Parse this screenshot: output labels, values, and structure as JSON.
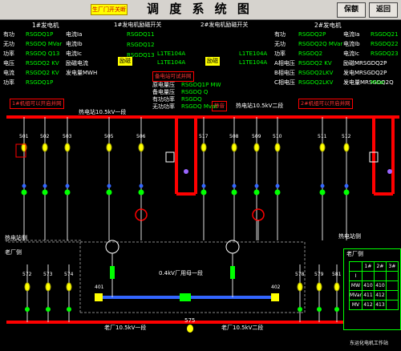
{
  "header": {
    "title": "调 度 系 统 图",
    "warn_badge": "生厂门开关断",
    "btn_left": "保额",
    "btn_right": "返回"
  },
  "gen1": {
    "title": "1#发电机",
    "rows": [
      {
        "label": "有功",
        "value": "RSGDQ1P",
        "unit": "电流Ia"
      },
      {
        "label": "无功",
        "value": "RSGDQ MVar",
        "unit": "电流Ib"
      },
      {
        "label": "功率",
        "value": "RSGDQ Q13",
        "unit": "电流Ic"
      },
      {
        "label": "电压",
        "value": "RSGDQ2 KV",
        "unit": "励磁电流"
      },
      {
        "label": "电流",
        "value": "RSGDQ2 KV",
        "unit": "发电量MWH"
      },
      {
        "label": "功率",
        "value": "RSGDQ1P",
        "unit": ""
      }
    ]
  },
  "gen2": {
    "title": "2#发电机",
    "rows": [
      {
        "label": "有功",
        "value": "RSGDQ2P",
        "unit": "电流Ia",
        "extra": "RSGDQ21"
      },
      {
        "label": "无功",
        "value": "RSGDQ2Q MVar",
        "unit": "电流Ib",
        "extra": "RSGDQ22"
      },
      {
        "label": "功率",
        "value": "RSGDQ2",
        "unit": "电流Ic",
        "extra": "RSGDQ23"
      },
      {
        "label": "A相电压",
        "value": "RSGDQ2 KV",
        "unit": "励磁MRSGDQ2P",
        "extra": ""
      },
      {
        "label": "B相电压",
        "value": "RSGDQ2LKV",
        "unit": "发电MRSGDQ2P",
        "extra": ""
      },
      {
        "label": "C相电压",
        "value": "RSGDQ2LKV",
        "unit": "发电量MRSGDQ2Q",
        "extra": "MVar"
      }
    ]
  },
  "center_left": {
    "title": "1#发电机励磁开关",
    "rows": [
      "RSGDQ11",
      "RSGDQ12",
      "RSGDQ13"
    ],
    "tag": "励磁",
    "sub_rows": [
      "L1TE104A",
      "L1TE104A"
    ]
  },
  "center_right": {
    "title": "2#发电机励磁开关",
    "tag": "励磁",
    "sub_rows": [
      "L1TE104A",
      "L1TE104A"
    ]
  },
  "sync_panel": {
    "title": "备电站可试并网",
    "rows": [
      {
        "label": "原电量压",
        "value": "RSGDQ1P MW"
      },
      {
        "label": "备电量压",
        "value": "RSGDQ Q"
      },
      {
        "label": "有功功率",
        "value": "RSGDQ"
      },
      {
        "label": "无功功率",
        "value": "RSGDQ Mvar"
      }
    ]
  },
  "alerts": {
    "left": "1#机组可以开启并网",
    "right": "2#机组可以开启并网",
    "mid": "静音"
  },
  "bus": {
    "left": "热电站10.5kV一段",
    "right": "热电站10.5kV二段",
    "low": "0.4kV厂用母一段",
    "bottom_left": "老厂10.5kV一段",
    "bottom_right": "老厂10.5kV二段",
    "tie": "575"
  },
  "station": {
    "left": "热电站侧",
    "left2": "老厂侧",
    "right": "热电站侧",
    "right2": "老厂侧"
  },
  "breakers_top": [
    "501",
    "502",
    "503",
    "505",
    "506",
    "517",
    "508",
    "509",
    "510",
    "511",
    "512"
  ],
  "breakers_bottom": [
    "572",
    "573",
    "574",
    "578",
    "579",
    "581"
  ],
  "low_breakers": [
    "401",
    "402"
  ],
  "legend": {
    "header": [
      "1#",
      "2#",
      "3#"
    ],
    "rows": [
      {
        "label": "I",
        "vals": [
          "",
          "",
          ""
        ]
      },
      {
        "label": "MW",
        "vals": [
          "410",
          "410",
          ""
        ]
      },
      {
        "label": "MVar",
        "vals": [
          "411",
          "412",
          ""
        ]
      },
      {
        "label": "MV",
        "vals": [
          "412",
          "413",
          ""
        ]
      }
    ]
  },
  "footer": "东运化电机工作站"
}
